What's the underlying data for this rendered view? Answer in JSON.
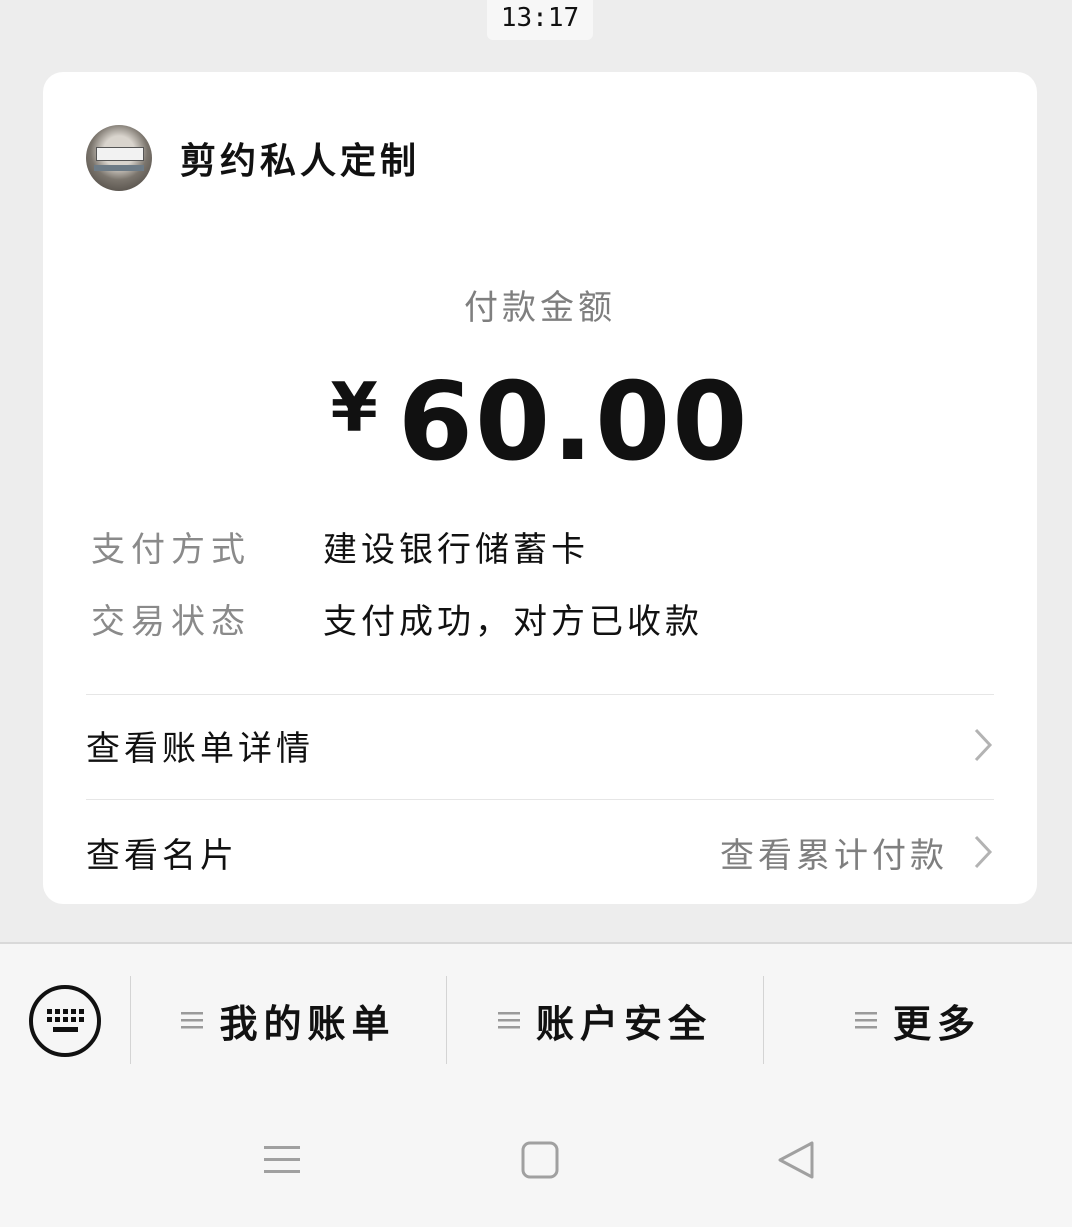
{
  "status_bar": {
    "time": "13:17"
  },
  "merchant": {
    "name": "剪约私人定制"
  },
  "payment": {
    "amount_label": "付款金额",
    "currency_symbol": "¥",
    "amount": "60.00"
  },
  "details": [
    {
      "key": "支付方式",
      "value": "建设银行储蓄卡"
    },
    {
      "key": "交易状态",
      "value": "支付成功，对方已收款"
    }
  ],
  "links": {
    "bill_detail": {
      "label": "查看账单详情"
    },
    "card": {
      "label": "查看名片",
      "sub": "查看累计付款"
    }
  },
  "menu": {
    "items": [
      {
        "label": "我的账单"
      },
      {
        "label": "账户安全"
      },
      {
        "label": "更多"
      }
    ]
  },
  "icons": {
    "keyboard": "keyboard-icon",
    "chevron": "chevron-right-icon",
    "menu": "hamburger-icon",
    "nav_recent": "nav-recent-icon",
    "nav_home": "nav-home-icon",
    "nav_back": "nav-back-icon"
  },
  "colors": {
    "background": "#ededed",
    "card": "#ffffff",
    "primary_text": "#111111",
    "secondary_text": "#8a8a8a"
  }
}
